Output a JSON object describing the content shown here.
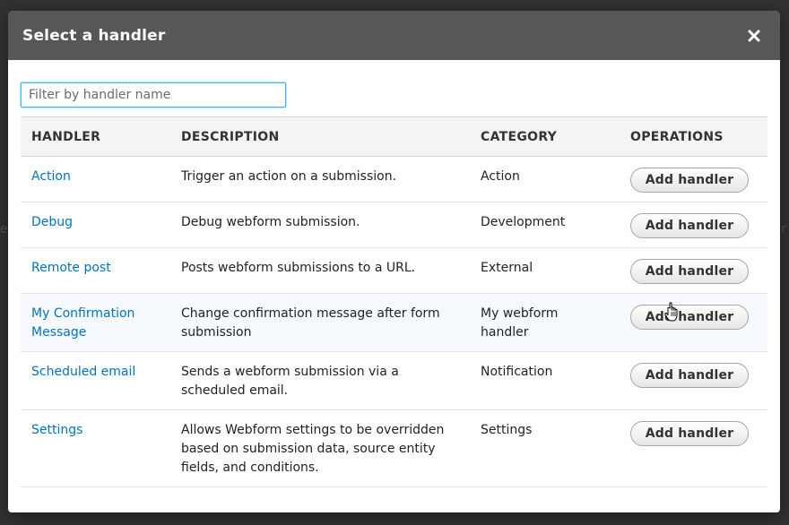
{
  "dialog": {
    "title": "Select a handler",
    "close_icon": "close-icon"
  },
  "filter": {
    "placeholder": "Filter by handler name",
    "value": ""
  },
  "table": {
    "headers": [
      "HANDLER",
      "DESCRIPTION",
      "CATEGORY",
      "OPERATIONS"
    ],
    "rows": [
      {
        "handler": "Action",
        "description": "Trigger an action on a submission.",
        "category": "Action",
        "operation": "Add handler"
      },
      {
        "handler": "Debug",
        "description": "Debug webform submission.",
        "category": "Development",
        "operation": "Add handler"
      },
      {
        "handler": "Remote post",
        "description": "Posts webform submissions to a URL.",
        "category": "External",
        "operation": "Add handler"
      },
      {
        "handler": "My Confirmation Message",
        "description": "Change confirmation message after form submission",
        "category": "My webform handler",
        "operation": "Add handler"
      },
      {
        "handler": "Scheduled email",
        "description": "Sends a webform submission via a scheduled email.",
        "category": "Notification",
        "operation": "Add handler"
      },
      {
        "handler": "Settings",
        "description": "Allows Webform settings to be overridden based on submission data, source entity fields, and conditions.",
        "category": "Settings",
        "operation": "Add handler"
      }
    ]
  },
  "colors": {
    "header_bg": "#575757",
    "link": "#0074bd",
    "focus": "#40b6ff"
  }
}
